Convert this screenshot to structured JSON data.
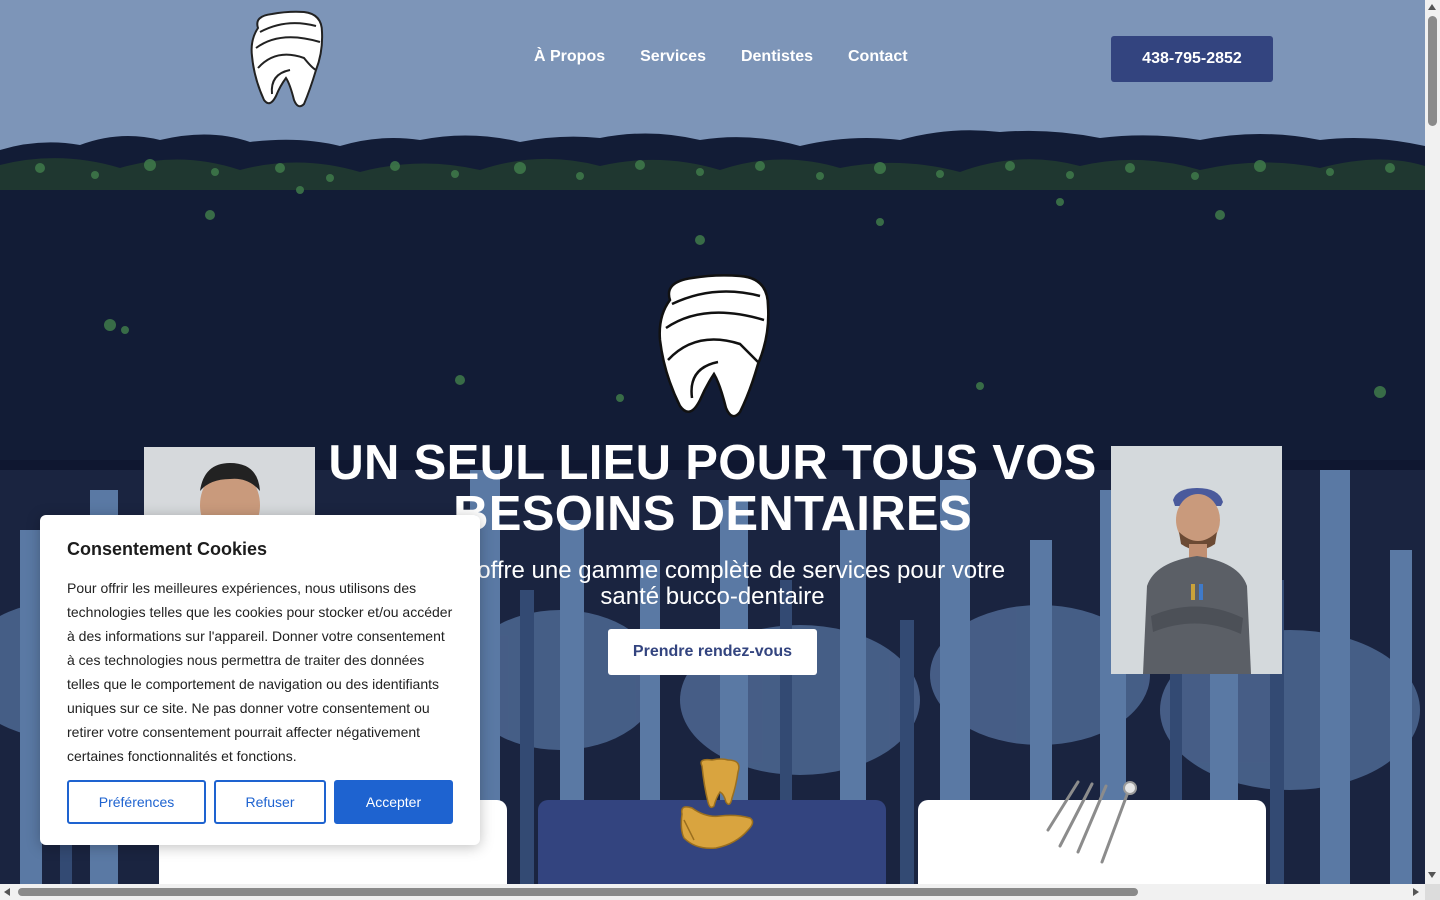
{
  "nav": {
    "items": [
      "À Propos",
      "Services",
      "Dentistes",
      "Contact"
    ],
    "phone": "438-795-2852"
  },
  "hero": {
    "title_line1": "UN SEUL LIEU POUR TOUS VOS",
    "title_line2": "BESOINS DENTAIRES",
    "subtitle_line1": "vous offre une gamme complète de services pour votre",
    "subtitle_line2": "santé bucco-dentaire",
    "cta": "Prendre rendez-vous"
  },
  "cookie": {
    "title": "Consentement Cookies",
    "body": "Pour offrir les meilleures expériences, nous utilisons des technologies telles que les cookies pour stocker et/ou accéder à des informations sur l'appareil. Donner votre consentement à ces technologies nous permettra de traiter des données telles que le comportement de navigation ou des identifiants uniques sur ce site. Ne pas donner votre consentement ou retirer votre consentement pourrait affecter négativement certaines fonctionnalités et fonctions.",
    "preferences": "Préférences",
    "refuse": "Refuser",
    "accept": "Accepter"
  },
  "colors": {
    "sky": "#7d95b8",
    "night": "#0f1730",
    "brand_blue": "#33447f",
    "cookie_blue": "#1e63d0",
    "foliage": "#3f7a4a"
  },
  "icons": [
    "tooth-logo-icon",
    "tooth-hero-icon",
    "toothbrush-icon",
    "tooth-hand-icon",
    "dental-tools-icon"
  ]
}
